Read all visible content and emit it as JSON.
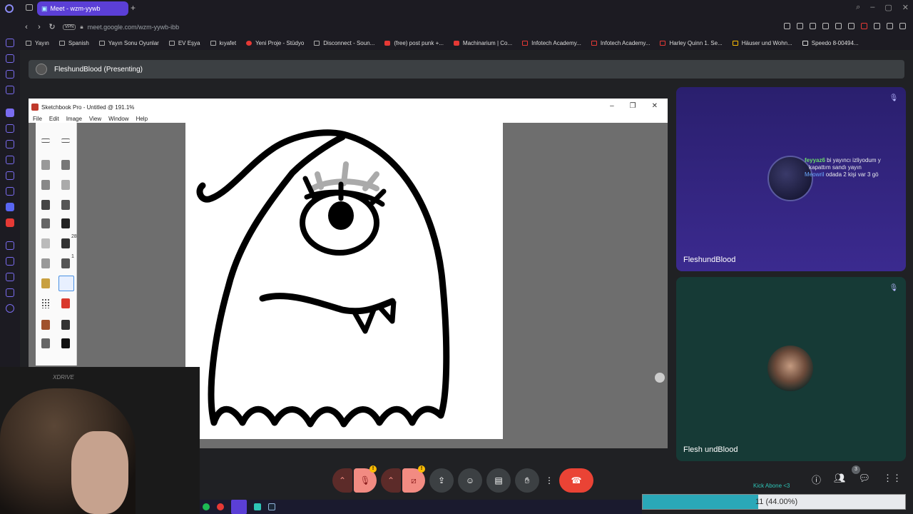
{
  "browser": {
    "tab_title": "Meet - wzm-yywb",
    "tab_new": "+",
    "url": "meet.google.com/wzm-yywb-ibb",
    "vpn_label": "VPN"
  },
  "bookmarks": [
    "Yayın",
    "Spanish",
    "Yayın Sonu Oyunlar",
    "EV Eşya",
    "kıyafet",
    "Yeni Proje - Stüdyo",
    "Disconnect - Soun...",
    "(free) post punk +...",
    "Machinarium | Co...",
    "Infotech Academy...",
    "Infotech Academy...",
    "Harley Quinn 1. Se...",
    "Häuser und Wohn...",
    "Speedo 8-00494..."
  ],
  "presenting": {
    "label": "FleshundBlood (Presenting)"
  },
  "sketchbook": {
    "title": "Sketchbook Pro - Untitled @ 191.1%",
    "menu": [
      "File",
      "Edit",
      "Image",
      "View",
      "Window",
      "Help"
    ],
    "brush_num_1": "28",
    "brush_num_2": "1"
  },
  "webcam": {
    "brand": "XDRIVE"
  },
  "participants": [
    {
      "name": "FleshundBlood",
      "chat": [
        {
          "user": "feyyaz6",
          "text": "bi yayıncı izliyodum y"
        },
        {
          "user": "",
          "text": "kapattım sandı yayın"
        },
        {
          "user": "Meowril",
          "text": "odada 2 kişi var 3 gö"
        }
      ]
    },
    {
      "name": "Flesh undBlood"
    }
  ],
  "controls": {
    "people_count": "3",
    "warn": "!"
  },
  "overlay": {
    "kick_label": "Kick Abone <3",
    "progress_text": "11 (44.00%)",
    "progress_value": 0.44
  },
  "colors": {
    "accent": "#5b3fd6",
    "end_call": "#ea4335",
    "tile1_bg": "#2a1f6e",
    "tile2_bg": "#163a36",
    "progress_fill": "#2aa8b8"
  }
}
